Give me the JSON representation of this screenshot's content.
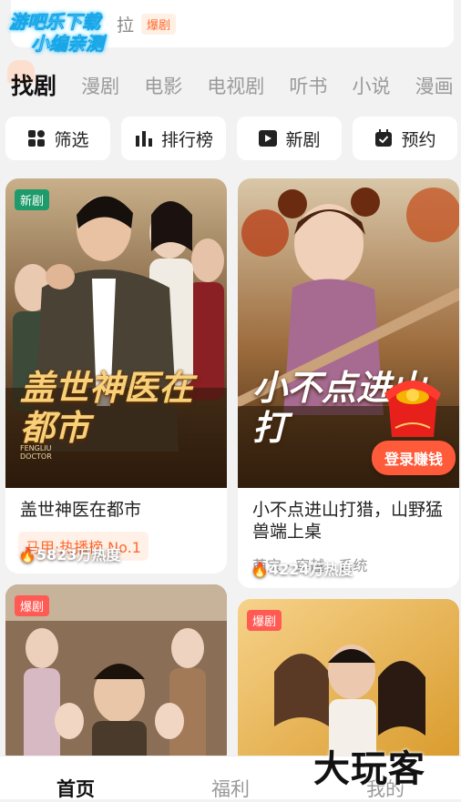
{
  "watermark": {
    "line1": "游吧乐下载",
    "line2": "小编亲测"
  },
  "search": {
    "query": "拉",
    "tag": "爆剧"
  },
  "category_tabs": [
    "找剧",
    "漫剧",
    "电影",
    "电视剧",
    "听书",
    "小说",
    "漫画"
  ],
  "quick_buttons": [
    {
      "label": "筛选",
      "icon": "filter-grid-icon"
    },
    {
      "label": "排行榜",
      "icon": "bar-chart-icon"
    },
    {
      "label": "新剧",
      "icon": "play-square-icon"
    },
    {
      "label": "预约",
      "icon": "calendar-check-icon"
    }
  ],
  "cards": [
    {
      "badge": "新剧",
      "badge_color": "#1e9b6a",
      "poster_title": "盖世神医在都市",
      "poster_subtitle": "FENGLIU DOCTOR",
      "heat": "5823万热度",
      "title": "盖世神医在都市",
      "rank": "马甲·热播榜 No.1"
    },
    {
      "poster_title": "小不点进山打",
      "heat": "4224万热度",
      "title": "小不点进山打猎，山野猛兽端上桌",
      "genres": "萌宝 · 穿越 · 系统"
    },
    {
      "badge": "爆剧",
      "badge_color": "#ff5a54"
    },
    {
      "badge": "爆剧",
      "badge_color": "#ff5a54"
    }
  ],
  "promo": {
    "login_button": "登录赚钱"
  },
  "bottom_nav": [
    "首页",
    "福利",
    "我的"
  ],
  "brand": "大玩客",
  "colors": {
    "accent": "#ff6a2e",
    "background": "#f2f2f2",
    "new_badge": "#1e9b6a",
    "hot_badge": "#ff5a54"
  }
}
